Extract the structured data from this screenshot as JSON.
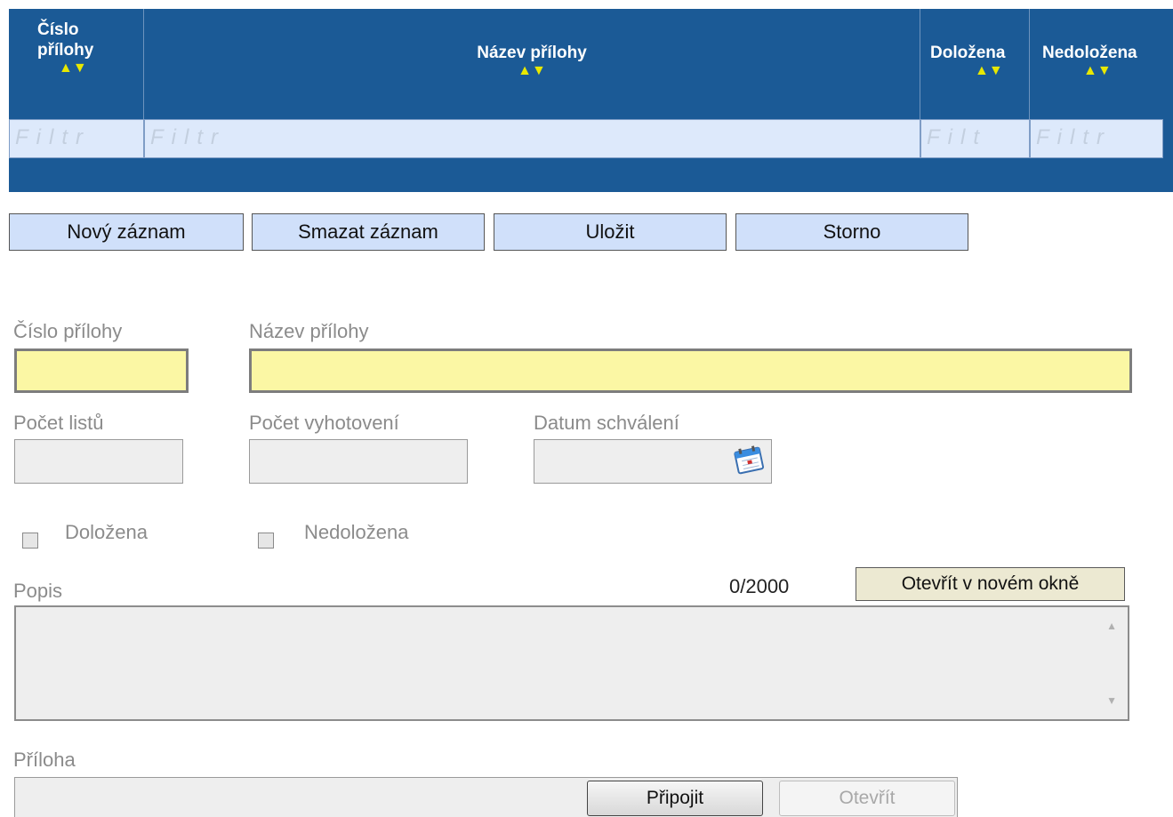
{
  "grid": {
    "columns": [
      {
        "label": "Číslo přílohy",
        "lines": [
          "Číslo",
          "přílohy"
        ],
        "sort": "▲▼"
      },
      {
        "label": "Název přílohy",
        "lines": [
          "Název přílohy"
        ],
        "sort": "▲▼"
      },
      {
        "label": "Doložena",
        "lines": [
          "Doložena"
        ],
        "sort": "▲▼"
      },
      {
        "label": "Nedoložena",
        "lines": [
          "Nedoložena"
        ],
        "sort": "▲▼"
      }
    ],
    "filters": [
      "Filtr",
      "Filtr",
      "Filt",
      "Filtr"
    ]
  },
  "toolbar": {
    "new": "Nový záznam",
    "delete": "Smazat záznam",
    "save": "Uložit",
    "cancel": "Storno"
  },
  "form": {
    "cislo_label": "Číslo přílohy",
    "cislo_value": "",
    "nazev_label": "Název přílohy",
    "nazev_value": "",
    "pocet_listu_label": "Počet listů",
    "pocet_listu_value": "",
    "pocet_vyhotoveni_label": "Počet vyhotovení",
    "pocet_vyhotoveni_value": "",
    "datum_label": "Datum schválení",
    "datum_value": "",
    "dolozena_label": "Doložena",
    "dolozena_checked": false,
    "nedolozena_label": "Nedoložena",
    "nedolozena_checked": false,
    "popis_label": "Popis",
    "popis_counter": "0/2000",
    "open_new_window": "Otevřít v novém okně",
    "priloha_label": "Příloha",
    "attach_button": "Připojit",
    "open_button": "Otevřít"
  },
  "colors": {
    "header_bg": "#1b5a96",
    "sort_arrows": "#e8e800",
    "filter_bg": "#dde9fb",
    "required_field": "#fbf7a4",
    "button_bg": "#d0e0fa"
  }
}
